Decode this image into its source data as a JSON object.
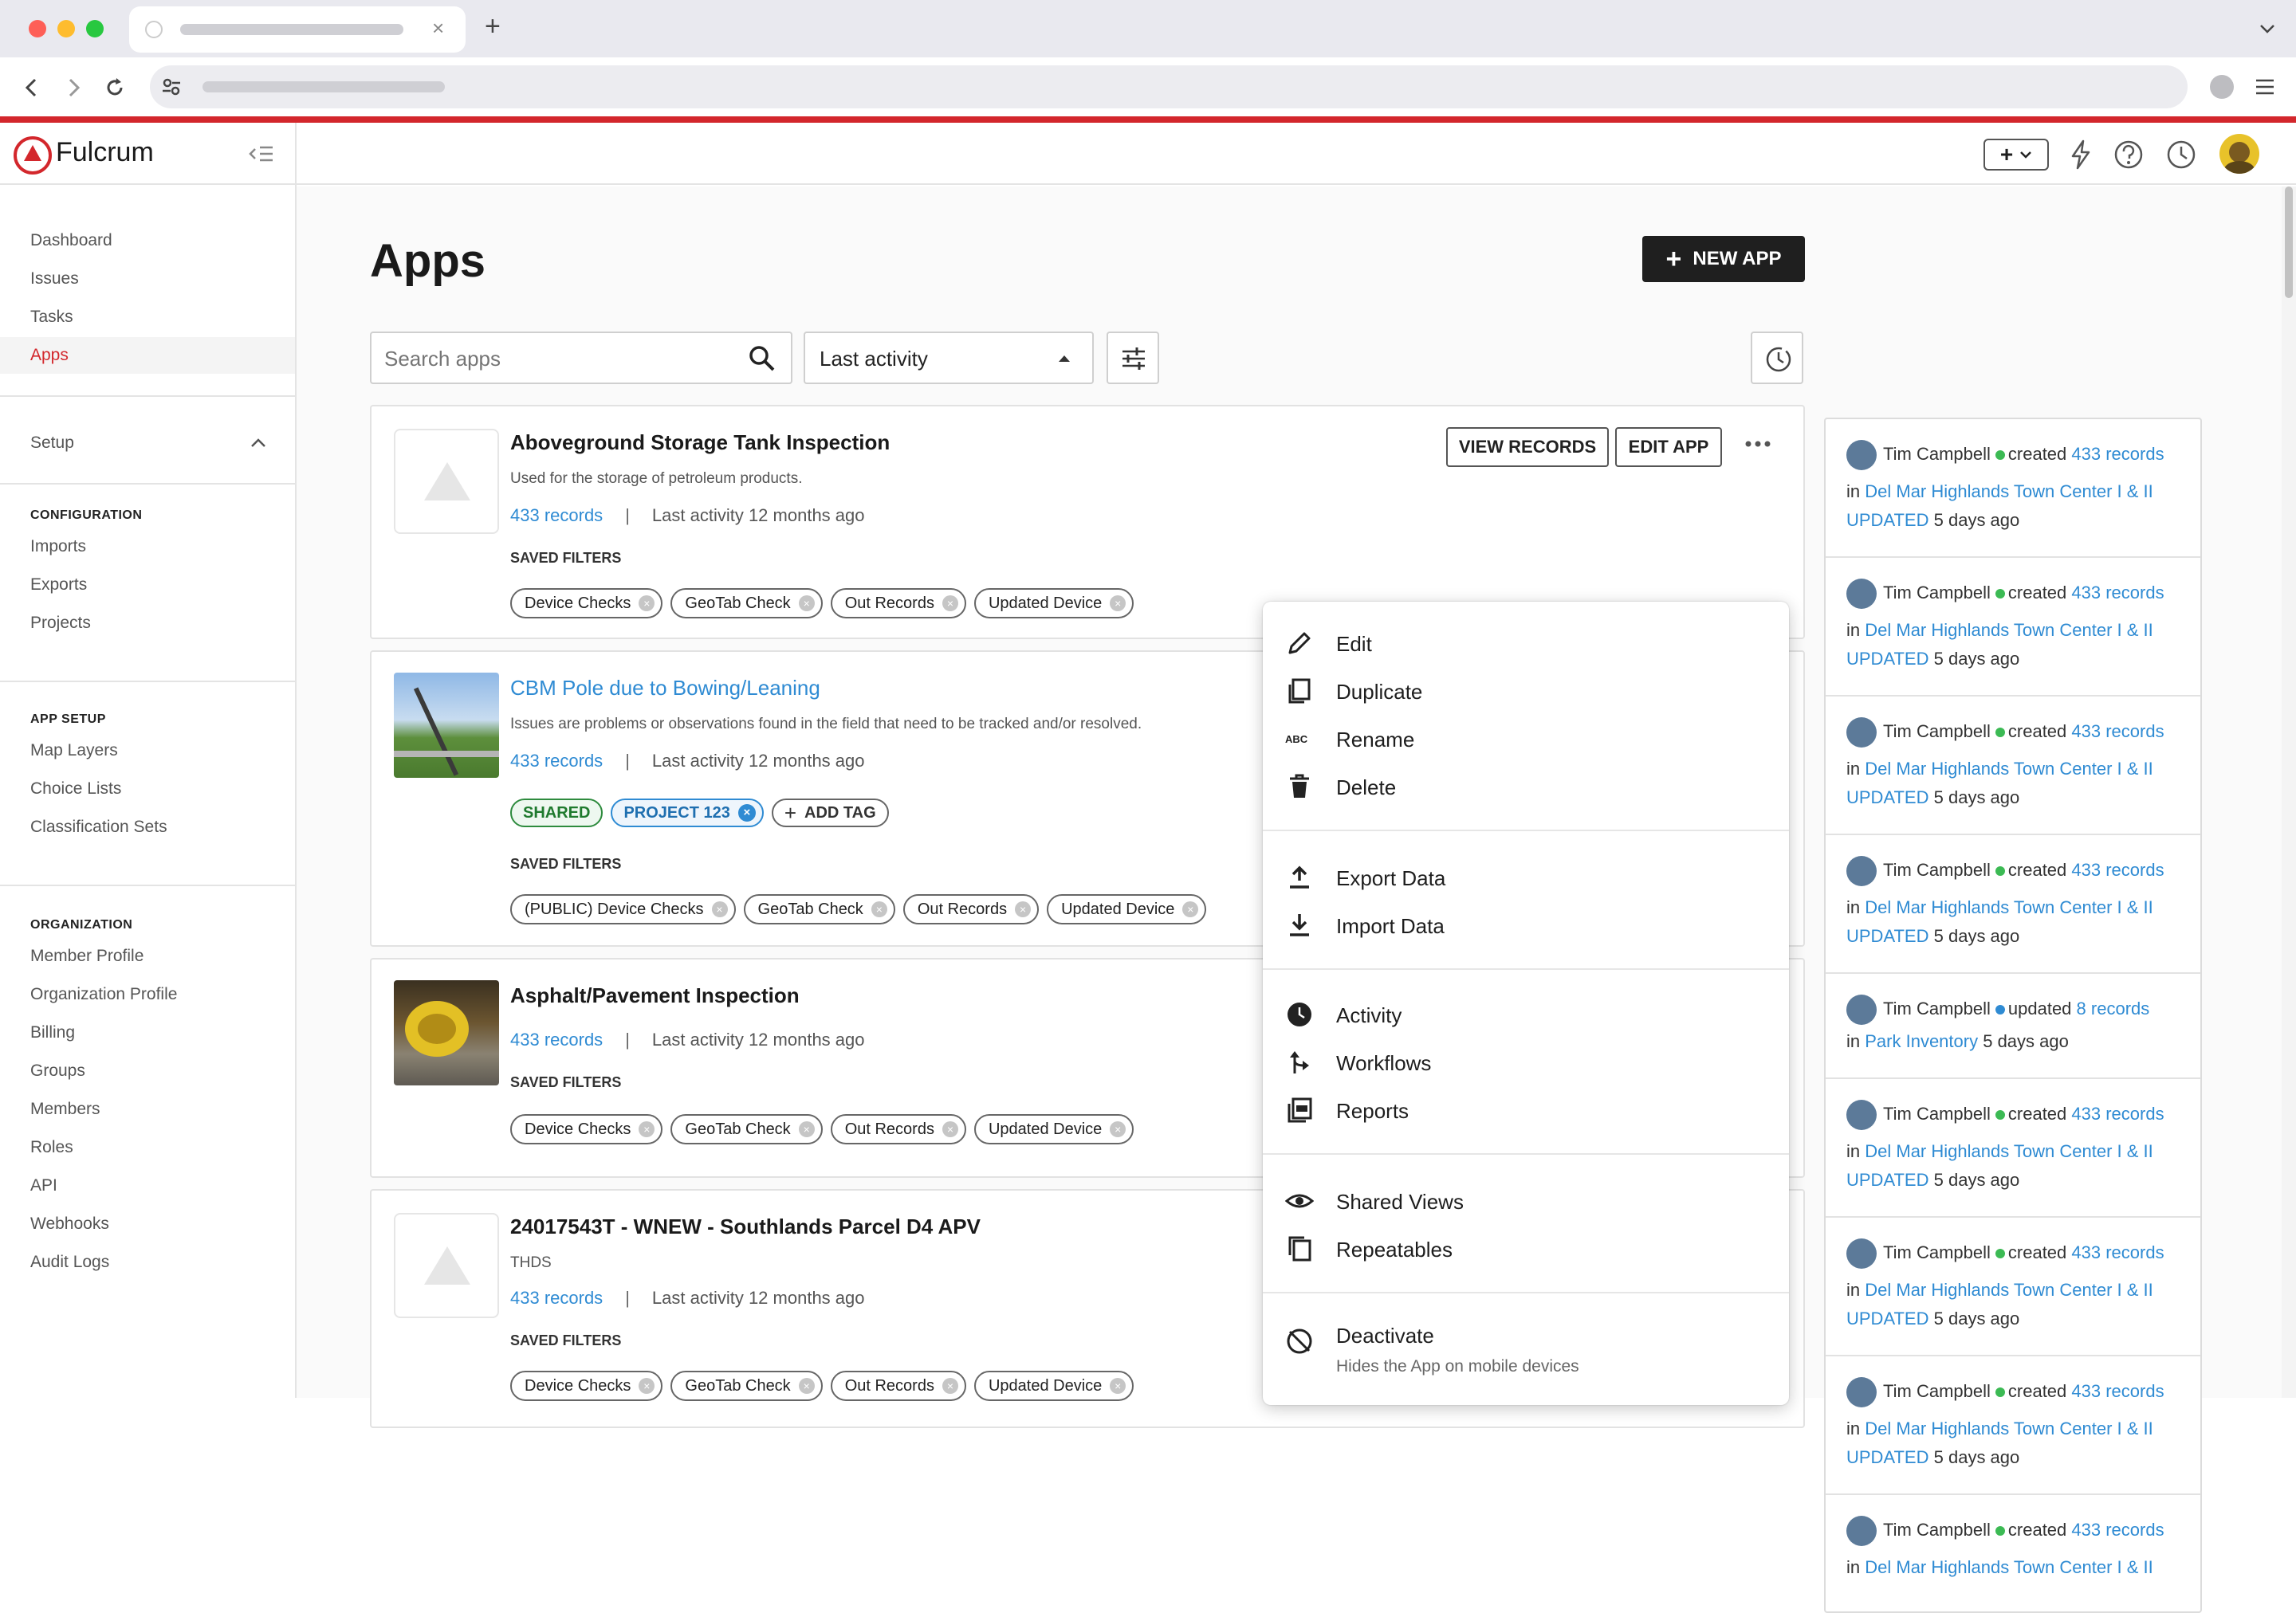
{
  "brand": {
    "name": "Fulcrum"
  },
  "colors": {
    "accent": "#d3272c",
    "link": "#2f8bd3",
    "created_dot": "#3cba54",
    "updated_dot": "#2f8bd3"
  },
  "sidebar": {
    "items": [
      {
        "label": "Dashboard"
      },
      {
        "label": "Issues"
      },
      {
        "label": "Tasks"
      },
      {
        "label": "Apps"
      }
    ],
    "setup": "Setup",
    "configuration": {
      "title": "CONFIGURATION",
      "items": [
        "Imports",
        "Exports",
        "Projects"
      ]
    },
    "app_setup": {
      "title": "APP SETUP",
      "items": [
        "Map Layers",
        "Choice Lists",
        "Classification Sets"
      ]
    },
    "organization": {
      "title": "ORGANIZATION",
      "items": [
        "Member Profile",
        "Organization Profile",
        "Billing",
        "Groups",
        "Members",
        "Roles",
        "API",
        "Webhooks",
        "Audit Logs"
      ]
    }
  },
  "page": {
    "title": "Apps",
    "new_app": "NEW APP",
    "search_placeholder": "Search apps",
    "sort_value": "Last activity"
  },
  "apps": [
    {
      "title": "Aboveground Storage Tank Inspection",
      "description": "Used for the storage of petroleum products.",
      "records": "433 records",
      "sep": "|",
      "activity": "Last activity 12 months ago",
      "saved_filters_label": "SAVED FILTERS",
      "filters": [
        "Device Checks",
        "GeoTab Check",
        "Out Records",
        "Updated Device"
      ],
      "view_records": "VIEW RECORDS",
      "edit_app": "EDIT APP"
    },
    {
      "title": "CBM Pole due to Bowing/Leaning",
      "description": "Issues are problems or observations found in the field that need to be tracked and/or resolved.",
      "records": "433 records",
      "sep": "|",
      "activity": "Last activity 12 months ago",
      "tags": [
        "SHARED",
        "PROJECT 123"
      ],
      "add_tag": "ADD TAG",
      "saved_filters_label": "SAVED FILTERS",
      "filters": [
        "(PUBLIC) Device Checks",
        "GeoTab Check",
        "Out Records",
        "Updated Device"
      ]
    },
    {
      "title": "Asphalt/Pavement Inspection",
      "records": "433 records",
      "sep": "|",
      "activity": "Last activity 12 months ago",
      "saved_filters_label": "SAVED FILTERS",
      "filters": [
        "Device Checks",
        "GeoTab Check",
        "Out Records",
        "Updated Device"
      ]
    },
    {
      "title": "24017543T - WNEW - Southlands Parcel D4 APV",
      "description": "THDS",
      "records": "433 records",
      "sep": "|",
      "activity": "Last activity 12 months ago",
      "saved_filters_label": "SAVED FILTERS",
      "filters": [
        "Device Checks",
        "GeoTab Check",
        "Out Records",
        "Updated Device"
      ]
    }
  ],
  "menu": {
    "edit": "Edit",
    "duplicate": "Duplicate",
    "rename": "Rename",
    "delete": "Delete",
    "export": "Export Data",
    "import": "Import Data",
    "activity": "Activity",
    "workflows": "Workflows",
    "reports": "Reports",
    "shared_views": "Shared Views",
    "repeatables": "Repeatables",
    "deactivate": "Deactivate",
    "deactivate_sub": "Hides the App on mobile devices"
  },
  "feed": [
    {
      "user": "Tim Campbell",
      "action": "created",
      "count": "433 records",
      "in": "in",
      "target": "Del Mar Highlands Town Center I & II",
      "status": "UPDATED",
      "time": "5 days ago"
    },
    {
      "user": "Tim Campbell",
      "action": "created",
      "count": "433 records",
      "in": "in",
      "target": "Del Mar Highlands Town Center I & II",
      "status": "UPDATED",
      "time": "5 days ago"
    },
    {
      "user": "Tim Campbell",
      "action": "created",
      "count": "433 records",
      "in": "in",
      "target": "Del Mar Highlands Town Center I & II",
      "status": "UPDATED",
      "time": "5 days ago"
    },
    {
      "user": "Tim Campbell",
      "action": "created",
      "count": "433 records",
      "in": "in",
      "target": "Del Mar Highlands Town Center I & II",
      "status": "UPDATED",
      "time": "5 days ago"
    },
    {
      "user": "Tim Campbell",
      "action": "updated",
      "count": "8 records",
      "in": "in",
      "target": "Park Inventory",
      "time": "5 days ago"
    },
    {
      "user": "Tim Campbell",
      "action": "created",
      "count": "433 records",
      "in": "in",
      "target": "Del Mar Highlands Town Center I & II",
      "status": "UPDATED",
      "time": "5 days ago"
    },
    {
      "user": "Tim Campbell",
      "action": "created",
      "count": "433 records",
      "in": "in",
      "target": "Del Mar Highlands Town Center I & II",
      "status": "UPDATED",
      "time": "5 days ago"
    },
    {
      "user": "Tim Campbell",
      "action": "created",
      "count": "433 records",
      "in": "in",
      "target": "Del Mar Highlands Town Center I & II",
      "status": "UPDATED",
      "time": "5 days ago"
    },
    {
      "user": "Tim Campbell",
      "action": "created",
      "count": "433 records",
      "in": "in",
      "target": "Del Mar Highlands Town Center I & II"
    }
  ]
}
